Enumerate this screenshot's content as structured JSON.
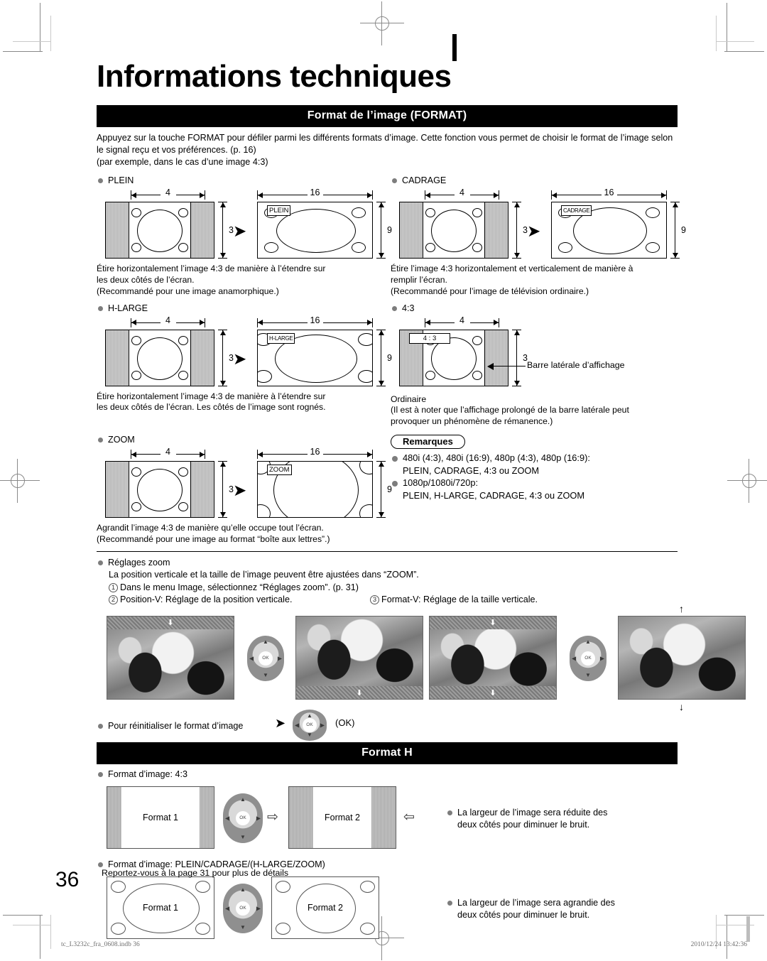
{
  "page": {
    "title": "Informations techniques",
    "number": "36"
  },
  "section_format": {
    "header": "Format de l’image (FORMAT)",
    "intro": "Appuyez sur la touche FORMAT pour défiler parmi les différents formats d’image. Cette fonction vous permet de choisir le format de l’image selon le signal reçu et vos préférences. (p. 16)",
    "intro2": "(par exemple, dans le cas d’une image 4:3)",
    "modes": [
      {
        "name": "PLEIN",
        "tag": "PLEIN",
        "dim_left_w": "4",
        "dim_left_h": "3",
        "dim_right_w": "16",
        "dim_right_h": "9",
        "caption1": "Étire horizontalement l’image 4:3 de manière à l’étendre sur",
        "caption2": "les deux côtés de l’écran.",
        "caption3": "(Recommandé pour une image anamorphique.)"
      },
      {
        "name": "CADRAGE",
        "tag": "CADRAGE",
        "dim_left_w": "4",
        "dim_left_h": "3",
        "dim_right_w": "16",
        "dim_right_h": "9",
        "caption1": "Étire l’image 4:3 horizontalement et verticalement de manière à",
        "caption2": "remplir l’écran.",
        "caption3": "(Recommandé pour l’image de télévision ordinaire.)"
      },
      {
        "name": "H-LARGE",
        "tag": "H-LARGE",
        "dim_left_w": "4",
        "dim_left_h": "3",
        "dim_right_w": "16",
        "dim_right_h": "9",
        "caption1": "Étire horizontalement l’image 4:3 de manière à l’étendre sur",
        "caption2": "les deux côtés de l’écran. Les côtés de l’image sont rognés.",
        "caption3": ""
      },
      {
        "name": "4:3",
        "tag": "4 : 3",
        "dim_left_w": "4",
        "dim_left_h": "3",
        "callout": "Barre latérale d’affichage",
        "caption1": "Ordinaire",
        "caption2": "(Il est à noter que l’affichage prolongé de la barre latérale peut",
        "caption3": "provoquer un phénomène de rémanence.)"
      },
      {
        "name": "ZOOM",
        "tag": "ZOOM",
        "dim_left_w": "4",
        "dim_left_h": "3",
        "dim_right_w": "16",
        "dim_right_h": "9",
        "caption1": "Agrandit l’image 4:3 de manière qu’elle occupe tout l’écran.",
        "caption2": "(Recommandé pour une image au format “boîte aux lettres”.)",
        "caption3": ""
      }
    ],
    "remarques": {
      "label": "Remarques",
      "items": [
        {
          "line1": "480i (4:3), 480i (16:9), 480p (4:3), 480p (16:9):",
          "line2": "PLEIN, CADRAGE, 4:3 ou ZOOM"
        },
        {
          "line1": "1080p/1080i/720p:",
          "line2": "PLEIN, H-LARGE, CADRAGE, 4:3 ou ZOOM"
        }
      ]
    },
    "zoom_settings": {
      "title": "Réglages zoom",
      "desc": "La position verticale et la taille de l’image peuvent être ajustées dans “ZOOM”.",
      "step1_num": "1",
      "step1": "Dans le menu Image, sélectionnez “Réglages zoom”. (p. 31)",
      "step2_num": "2",
      "step2": "Position-V: Réglage de la position verticale.",
      "step3_num": "3",
      "step3": "Format-V: Réglage de la taille verticale.",
      "ok_label": "OK",
      "dpad_center": "OK",
      "reset_text": "Pour réinitialiser le format d’image"
    }
  },
  "section_format_h": {
    "header": "Format H",
    "blocks": [
      {
        "label": "Format d’image: 4:3",
        "box1": "Format 1",
        "box2": "Format 2",
        "note1": "La largeur de l’image sera réduite des",
        "note2": "deux côtés pour diminuer le bruit."
      },
      {
        "label": "Format d’image: PLEIN/CADRAGE/(H-LARGE/ZOOM)",
        "box1": "Format 1",
        "box2": "Format 2",
        "note1": "La largeur de l’image sera agrandie des",
        "note2": "deux côtés pour diminuer le bruit."
      }
    ],
    "reference": "Reportez-vous à la page 31 pour plus de détails"
  },
  "footer": {
    "file": "tc_L3232c_fra_0608.indb   36",
    "timestamp": "2010/12/24   13:42:36"
  },
  "colors": {
    "bar_bg": "#000000",
    "bar_text": "#ffffff",
    "bullet": "#7d7d7d",
    "sidebar_gray": "#c0c0c0"
  }
}
